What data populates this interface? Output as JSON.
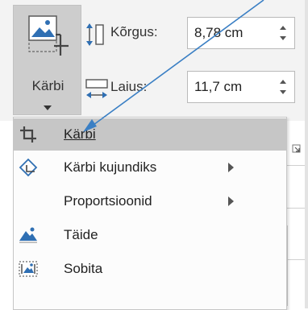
{
  "ribbon": {
    "crop_button_label": "Kärbi",
    "height_label": "Kõrgus:",
    "height_value": "8,78 cm",
    "width_label": "Laius:",
    "width_value": "11,7 cm"
  },
  "menu": {
    "items": [
      {
        "label": "Kärbi",
        "selected": true
      },
      {
        "label": "Kärbi kujundiks",
        "submenu": true
      },
      {
        "label": "Proportsioonid",
        "submenu": true
      },
      {
        "label": "Täide"
      },
      {
        "label": "Sobita"
      }
    ]
  },
  "colors": {
    "annotation_arrow": "#3a7fc4",
    "selected_bg": "#c6c6c6",
    "ribbon_bg": "#f3f3f3"
  }
}
